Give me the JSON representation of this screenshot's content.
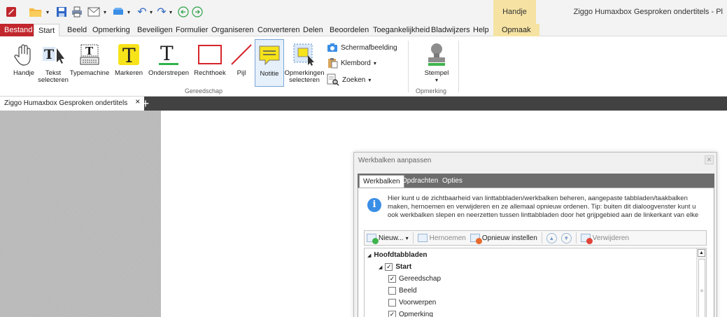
{
  "window": {
    "title": "Ziggo Humaxbox Gesproken ondertitels - Pl",
    "context_tab_header": "Handje"
  },
  "quick_access": [
    "app-logo-icon",
    "open-folder-icon",
    "save-icon",
    "print-icon",
    "email-icon",
    "scanner-icon",
    "undo-icon",
    "redo-icon",
    "back-icon",
    "forward-icon"
  ],
  "menu": {
    "file": "Bestand",
    "items": [
      "Start",
      "Beeld",
      "Opmerking",
      "Beveiligen",
      "Formulier",
      "Organiseren",
      "Converteren",
      "Delen",
      "Beoordelen",
      "Toegankelijkheid",
      "Bladwijzers",
      "Help"
    ],
    "context": "Opmaak"
  },
  "ribbon": {
    "tools": {
      "hand": "Handje",
      "select_text": "Tekst\nselecteren",
      "typewriter": "Typemachine",
      "highlight": "Markeren",
      "underline": "Onderstrepen",
      "rectangle": "Rechthoek",
      "arrow": "Pijl",
      "note": "Notitie",
      "select_comments": "Opmerkingen\nselecteren",
      "snapshot": "Schermafbeelding",
      "clipboard": "Klembord",
      "search": "Zoeken",
      "stamp": "Stempel"
    },
    "groups": {
      "tools": "Gereedschap",
      "comment": "Opmerking"
    }
  },
  "document_tab": {
    "title": "Ziggo Humaxbox Gesproken ondertitels",
    "close": "×",
    "add": "+"
  },
  "dialog": {
    "title": "Werkbalken aanpassen",
    "tabs": [
      "Werkbalken",
      "Opdrachten",
      "Opties"
    ],
    "info": "Hier kunt u de zichtbaarheid van linttabbladen/werkbalken beheren, aangepaste tabbladen/taakbalken maken, hernoemen en verwijderen en ze allemaal opnieuw ordenen. Tip: buiten dit dialoogvenster kunt u ook werkbalken slepen en neerzetten tussen linttabbladen door het grijpgebied aan de linkerkant van elke",
    "toolbar": {
      "new": "Nieuw...",
      "rename": "Hernoemen",
      "reset": "Opnieuw instellen",
      "delete": "Verwijderen"
    },
    "tree": [
      {
        "label": "Hoofdtabbladen",
        "level": 0,
        "expander": "◢",
        "checked": null,
        "bold": true
      },
      {
        "label": "Start",
        "level": 1,
        "expander": "◢",
        "checked": true,
        "bold": true
      },
      {
        "label": "Gereedschap",
        "level": 2,
        "expander": "",
        "checked": true,
        "bold": false
      },
      {
        "label": "Beeld",
        "level": 2,
        "expander": "",
        "checked": false,
        "bold": false
      },
      {
        "label": "Voorwerpen",
        "level": 2,
        "expander": "",
        "checked": false,
        "bold": false
      },
      {
        "label": "Opmerking",
        "level": 2,
        "expander": "",
        "checked": true,
        "bold": false
      }
    ]
  },
  "colors": {
    "brand_red": "#c1272d",
    "context_tab": "#f6e3a3",
    "doc_background": "#bdbdbd",
    "tabstrip": "#424242",
    "accent_blue": "#3a8ee6"
  }
}
